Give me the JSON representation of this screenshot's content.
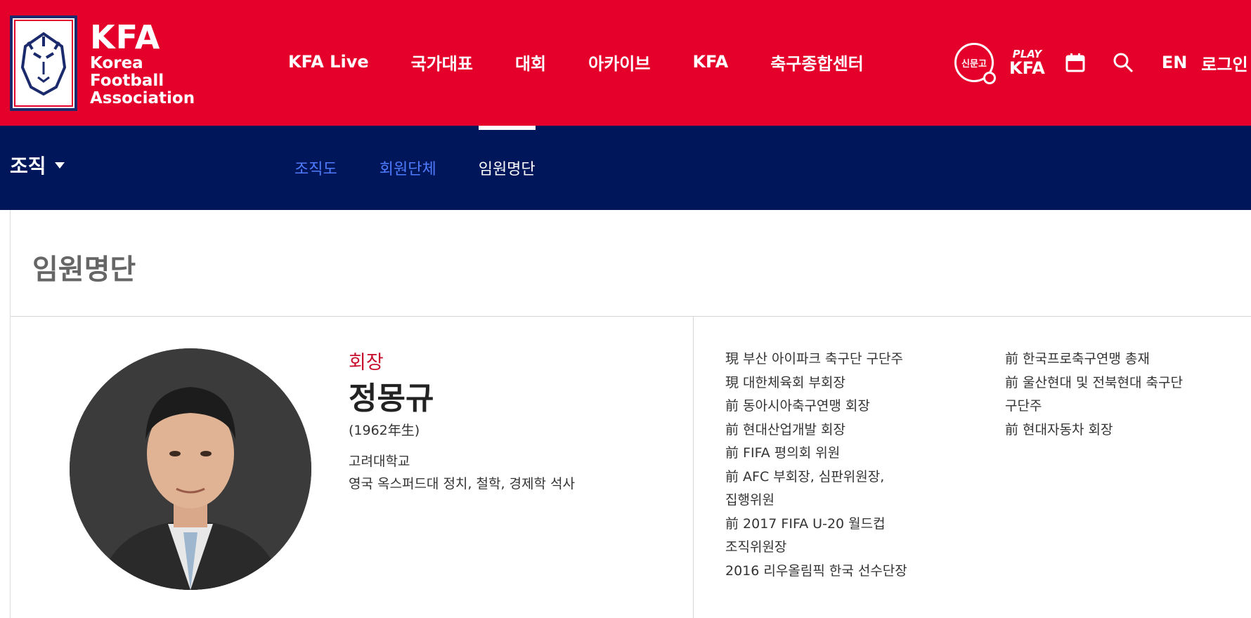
{
  "header": {
    "logo": {
      "title": "KFA",
      "line1": "Korea Football",
      "line2": "Association"
    },
    "nav": [
      {
        "label": "KFA Live"
      },
      {
        "label": "국가대표"
      },
      {
        "label": "대회"
      },
      {
        "label": "아카이브"
      },
      {
        "label": "KFA"
      },
      {
        "label": "축구종합센터"
      }
    ],
    "tools": {
      "newspaper_label": "신문고",
      "play_kfa_top": "PLAY",
      "play_kfa_bottom": "KFA",
      "lang_label": "EN",
      "login_label": "로그인"
    }
  },
  "sub_nav": {
    "section_label": "조직",
    "tabs": [
      {
        "label": "조직도",
        "active": false
      },
      {
        "label": "회원단체",
        "active": false
      },
      {
        "label": "임원명단",
        "active": true
      }
    ]
  },
  "page": {
    "title": "임원명단"
  },
  "profile": {
    "position": "회장",
    "name": "정몽규",
    "birth": "(1962年生)",
    "education": [
      "고려대학교",
      "영국 옥스퍼드대 정치, 철학, 경제학 석사"
    ],
    "career_left": [
      "現 부산 아이파크 축구단 구단주",
      "現 대한체육회 부회장",
      "前 동아시아축구연맹 회장",
      "前 현대산업개발 회장",
      "前 FIFA 평의회 위원",
      "前 AFC 부회장, 심판위원장,",
      "집행위원",
      "前 2017 FIFA U-20 월드컵",
      "조직위원장",
      "2016 리우올림픽 한국 선수단장"
    ],
    "career_right": [
      "前 한국프로축구연맹 총재",
      "前 울산현대 및 전북현대 축구단",
      "구단주",
      "前 현대자동차 회장"
    ]
  },
  "colors": {
    "header_red": "#e4002b",
    "subnav_navy": "#00165a",
    "tab_blue": "#4f7cff",
    "position_red": "#c8102e"
  }
}
